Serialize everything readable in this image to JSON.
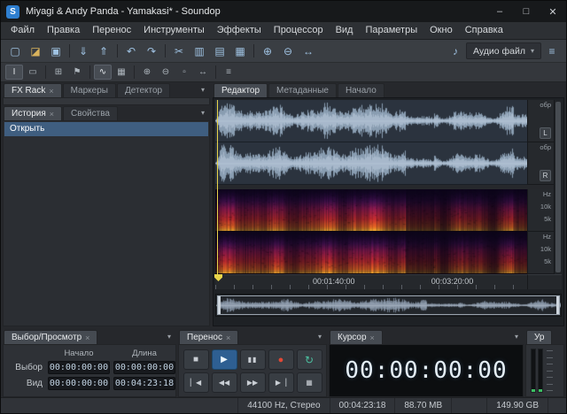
{
  "window": {
    "title": "Miyagi & Andy Panda - Yamakasi* - Soundop",
    "icon_letter": "S",
    "minimize": "–",
    "maximize": "□",
    "close": "✕"
  },
  "ui": {
    "close_glyph": "×",
    "menu_caret": "▾"
  },
  "menu": {
    "items": [
      "Файл",
      "Правка",
      "Перенос",
      "Инструменты",
      "Эффекты",
      "Процессор",
      "Вид",
      "Параметры",
      "Окно",
      "Справка"
    ]
  },
  "toolbar_main": {
    "buttons": [
      {
        "name": "new-file",
        "glyph": "▢"
      },
      {
        "name": "open-file",
        "glyph": "◪"
      },
      {
        "name": "save-file",
        "glyph": "▣"
      },
      {
        "name": "import-file",
        "glyph": "⇓"
      },
      {
        "name": "export-file",
        "glyph": "⇑"
      },
      {
        "name": "undo",
        "glyph": "↶"
      },
      {
        "name": "redo",
        "glyph": "↷"
      },
      {
        "name": "cut",
        "glyph": "✂"
      },
      {
        "name": "copy",
        "glyph": "▥"
      },
      {
        "name": "paste",
        "glyph": "▤"
      },
      {
        "name": "mix-paste",
        "glyph": "▦"
      },
      {
        "name": "zoom-in",
        "glyph": "⊕"
      },
      {
        "name": "zoom-out",
        "glyph": "⊖"
      },
      {
        "name": "zoom-full",
        "glyph": "↔"
      }
    ],
    "audio_device_glyph": "♪",
    "workspace_label": "Аудио файл",
    "panel_layout_glyph": "≡"
  },
  "toolbar_tools": {
    "buttons": [
      {
        "name": "time-select-tool",
        "glyph": "I"
      },
      {
        "name": "range-select-tool",
        "glyph": "▭"
      },
      {
        "name": "snap-toggle",
        "glyph": "⊞"
      },
      {
        "name": "marker-tool",
        "glyph": "⚑"
      },
      {
        "name": "waveform-view-toggle",
        "glyph": "∿"
      },
      {
        "name": "spectral-view-toggle",
        "glyph": "▦"
      },
      {
        "name": "zoom-in-tool",
        "glyph": "⊕"
      },
      {
        "name": "zoom-out-tool",
        "glyph": "⊖"
      },
      {
        "name": "zoom-selection-tool",
        "glyph": "▫"
      },
      {
        "name": "scroll-view-tool",
        "glyph": "↔"
      },
      {
        "name": "tools-menu",
        "glyph": "≡"
      }
    ]
  },
  "rack": {
    "tabs": [
      "FX Rack",
      "Маркеры",
      "Детектор"
    ]
  },
  "history": {
    "tabs": [
      "История",
      "Свойства"
    ],
    "items": [
      "Открыть"
    ]
  },
  "editor": {
    "tabs": [
      "Редактор",
      "Метаданные",
      "Начало"
    ],
    "amp_unit": "обр",
    "left_channel": "L",
    "right_channel": "R",
    "freq_unit": "Hz",
    "freq_tick_major": "10k",
    "freq_tick_minor": "5k",
    "time_labels": [
      "00:01:40:00",
      "00:03:20:00"
    ]
  },
  "selection": {
    "tab": "Выбор/Просмотр",
    "header_start": "Начало",
    "header_length": "Длина",
    "rows": [
      {
        "label": "Выбор",
        "start": "00:00:00:00",
        "length": "00:00:00:00"
      },
      {
        "label": "Вид",
        "start": "00:00:00:00",
        "length": "00:04:23:18"
      }
    ]
  },
  "transport": {
    "tab": "Перенос",
    "buttons": [
      {
        "name": "stop-button",
        "glyph": "■"
      },
      {
        "name": "play-button",
        "glyph": "▶"
      },
      {
        "name": "pause-button",
        "glyph": "▮▮"
      },
      {
        "name": "record-button",
        "glyph": "●"
      },
      {
        "name": "loop-playback-button",
        "glyph": "↻"
      },
      {
        "name": "go-to-start-button",
        "glyph": "▏◀"
      },
      {
        "name": "rewind-button",
        "glyph": "◀◀"
      },
      {
        "name": "fast-forward-button",
        "glyph": "▶▶"
      },
      {
        "name": "go-to-end-button",
        "glyph": "▶▕"
      },
      {
        "name": "play-options-button",
        "glyph": "▦"
      }
    ]
  },
  "cursor_panel": {
    "tab": "Курсор",
    "value": "00:00:00:00"
  },
  "level_panel": {
    "tab": "Ур"
  },
  "status": {
    "sample_rate": "44100 Hz, Стерео",
    "duration": "00:04:23:18",
    "file_size": "88.70 MB",
    "free_space": "149.90 GB"
  }
}
